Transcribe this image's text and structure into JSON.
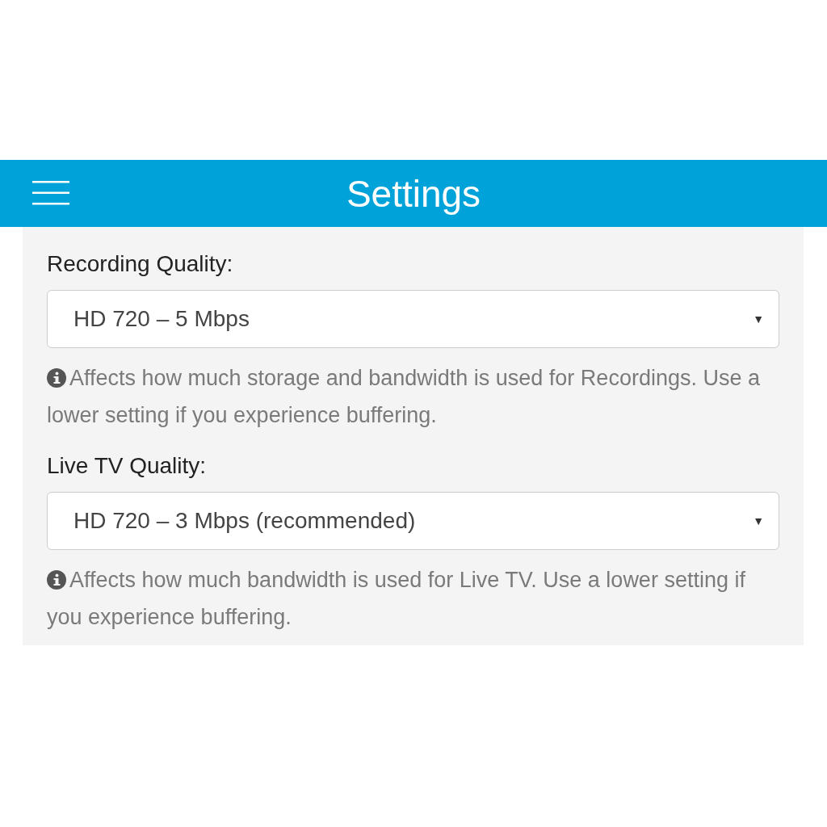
{
  "header": {
    "title": "Settings"
  },
  "settings": [
    {
      "label": "Recording Quality:",
      "value": "HD 720 – 5 Mbps",
      "arrow": "▼",
      "help": "Affects how much storage and bandwidth is used for Recordings. Use a lower setting if you experience buffering."
    },
    {
      "label": "Live TV Quality:",
      "value": "HD 720 – 3 Mbps (recommended)",
      "arrow": "▼",
      "help": "Affects how much bandwidth is used for Live TV. Use a lower setting if you experience buffering."
    }
  ]
}
